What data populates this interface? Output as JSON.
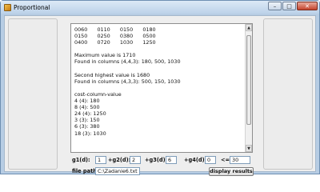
{
  "window": {
    "title": "Proportional"
  },
  "output": {
    "lines": [
      "0060      0110      0150      0180",
      "0150      0250      0380      0500",
      "0400      0720      1030      1250",
      "",
      "Maximum value is 1710",
      "Found in columns (4,4,3): 180, 500, 1030",
      "",
      "Second highest value is 1680",
      "Found in columns (4,3,3): 500, 150, 1030",
      "",
      "cost-column-value",
      "4 (4): 180",
      "8 (4): 500",
      "24 (4): 1250",
      "3 (3): 150",
      "6 (3): 380",
      "18 (3): 1030"
    ]
  },
  "form": {
    "g1": {
      "label": "g1(d):",
      "value": "1"
    },
    "g2": {
      "label": "+g2(d):",
      "value": "2"
    },
    "g3": {
      "label": "+g3(d):",
      "value": "6"
    },
    "g4": {
      "label": "+g4(d):",
      "value": "0"
    },
    "limit": {
      "label": "<=",
      "value": "30"
    },
    "file": {
      "label": "file path:",
      "value": "C:\\Zadanie6.txt"
    },
    "display_label": "display results"
  }
}
